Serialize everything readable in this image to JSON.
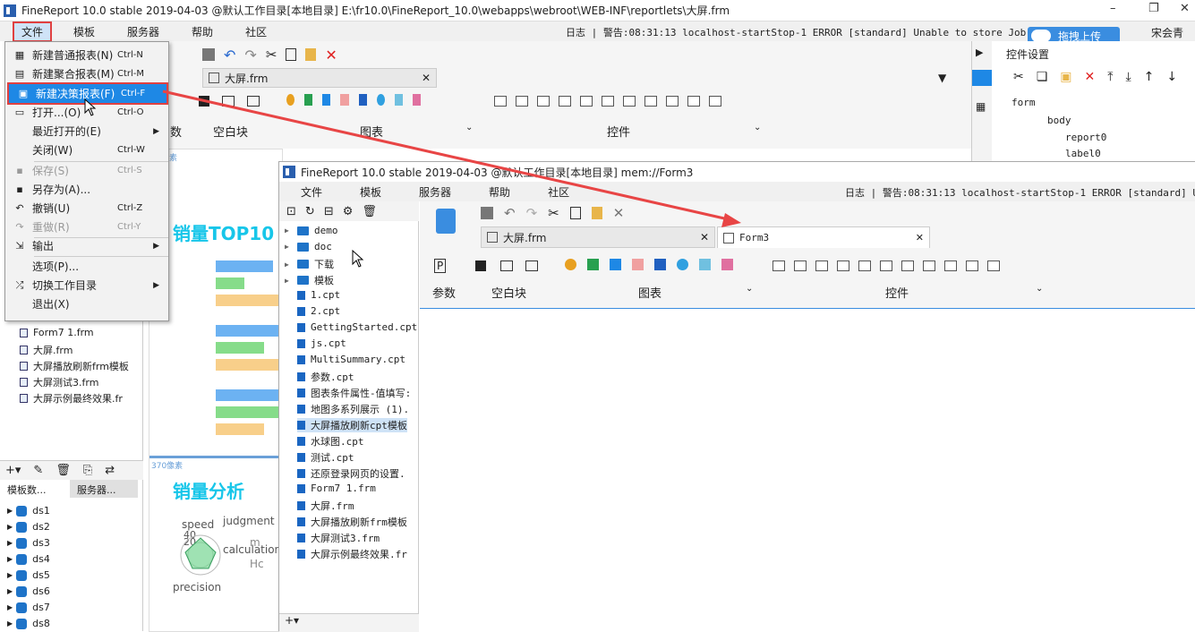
{
  "main_window": {
    "title": "FineReport 10.0 stable 2019-04-03 @默认工作目录[本地目录]    E:\\fr10.0\\FineReport_10.0\\webapps\\webroot\\WEB-INF\\reportlets\\大屏.frm",
    "menu": [
      "文件",
      "模板",
      "服务器",
      "帮助",
      "社区"
    ],
    "log_text": "日志 | 警告:08:31:13 localhost-startStop-1 ERROR [standard] Unable to store Job : 'GRO",
    "upload_label": "拖拽上传",
    "font_label": "宋会青",
    "tab_label": "大屏.frm",
    "groups": [
      "数",
      "空白块",
      "图表",
      "控件"
    ],
    "right_panel": {
      "title": "控件设置",
      "tree": [
        "form",
        "body",
        "report0",
        "label0"
      ]
    },
    "left_tree": [
      "Form7 1.frm",
      "大屏.frm",
      "大屏播放刷新frm模板",
      "大屏测试3.frm",
      "大屏示例最终效果.fr"
    ],
    "ds_tabs": [
      "模板数...",
      "服务器..."
    ],
    "datasets": [
      "ds1",
      "ds2",
      "ds3",
      "ds4",
      "ds5",
      "ds6",
      "ds7",
      "ds8"
    ],
    "canvas": {
      "top_text": "销量TOP10",
      "px_label_1": "素",
      "px_label_2": "370像素",
      "analysis": "销量分析",
      "radar_labels": [
        "speed",
        "judgment",
        "calculation",
        "precision",
        "40",
        "20"
      ],
      "legend": [
        "m",
        "Hc"
      ]
    }
  },
  "file_menu": [
    {
      "label": "新建普通报表(N)",
      "shortcut": "Ctrl-N",
      "icon": "grid-icon"
    },
    {
      "label": "新建聚合报表(M)",
      "shortcut": "Ctrl-M",
      "icon": "aggregate-icon"
    },
    {
      "label": "新建决策报表(F)",
      "shortcut": "Ctrl-F",
      "icon": "decision-icon"
    },
    {
      "label": "打开...(O)",
      "shortcut": "Ctrl-O",
      "icon": "folder-icon"
    },
    {
      "label": "最近打开的(E)",
      "shortcut": "",
      "icon": ""
    },
    {
      "label": "关闭(W)",
      "shortcut": "Ctrl-W",
      "icon": ""
    },
    {
      "label": "保存(S)",
      "shortcut": "Ctrl-S",
      "icon": "save-icon"
    },
    {
      "label": "另存为(A)...",
      "shortcut": "",
      "icon": "save-as-icon"
    },
    {
      "label": "撤销(U)",
      "shortcut": "Ctrl-Z",
      "icon": "undo-icon"
    },
    {
      "label": "重做(R)",
      "shortcut": "Ctrl-Y",
      "icon": "redo-icon"
    },
    {
      "label": "输出",
      "shortcut": "",
      "icon": "export-icon"
    },
    {
      "label": "选项(P)...",
      "shortcut": "",
      "icon": ""
    },
    {
      "label": "切换工作目录",
      "shortcut": "",
      "icon": "switch-icon"
    },
    {
      "label": "退出(X)",
      "shortcut": "",
      "icon": ""
    }
  ],
  "second_window": {
    "title": "FineReport 10.0 stable 2019-04-03 @默认工作目录[本地目录]    mem://Form3",
    "menu": [
      "文件",
      "模板",
      "服务器",
      "帮助",
      "社区"
    ],
    "log_text": "日志 | 警告:08:31:13 localhost-startStop-1 ERROR [standard] Unable",
    "tabs": [
      "大屏.frm",
      "Form3"
    ],
    "groups": [
      "参数",
      "空白块",
      "图表",
      "控件"
    ],
    "tree": [
      {
        "label": "demo",
        "type": "folder"
      },
      {
        "label": "doc",
        "type": "folder"
      },
      {
        "label": "下载",
        "type": "folder"
      },
      {
        "label": "模板",
        "type": "folder"
      },
      {
        "label": "1.cpt",
        "type": "file"
      },
      {
        "label": "2.cpt",
        "type": "file"
      },
      {
        "label": "GettingStarted.cpt",
        "type": "file"
      },
      {
        "label": "js.cpt",
        "type": "file"
      },
      {
        "label": "MultiSummary.cpt",
        "type": "file"
      },
      {
        "label": "参数.cpt",
        "type": "file"
      },
      {
        "label": "图表条件属性-值填写:",
        "type": "file"
      },
      {
        "label": "地图多系列展示 (1).",
        "type": "file"
      },
      {
        "label": "大屏播放刷新cpt模板",
        "type": "file"
      },
      {
        "label": "水球图.cpt",
        "type": "file"
      },
      {
        "label": "测试.cpt",
        "type": "file"
      },
      {
        "label": "还原登录网页的设置.",
        "type": "file"
      },
      {
        "label": "Form7 1.frm",
        "type": "file"
      },
      {
        "label": "大屏.frm",
        "type": "file"
      },
      {
        "label": "大屏播放刷新frm模板",
        "type": "file"
      },
      {
        "label": "大屏测试3.frm",
        "type": "file"
      },
      {
        "label": "大屏示例最终效果.fr",
        "type": "file"
      }
    ]
  },
  "colors": {
    "accent": "#1e88e5",
    "highlight_border": "#e04040",
    "title_cyan": "#17c6e9",
    "arrow": "#e84545"
  }
}
